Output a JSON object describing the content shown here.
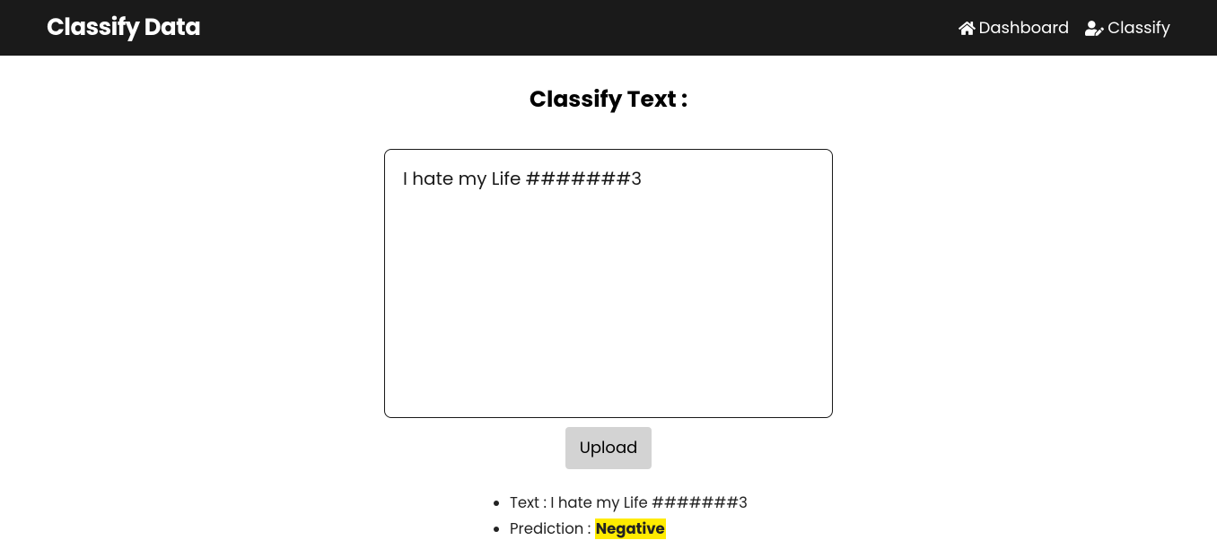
{
  "navbar": {
    "brand": "Classify Data",
    "links": {
      "dashboard": "Dashboard",
      "classify": "Classify"
    }
  },
  "main": {
    "title": "Classify Text :",
    "textarea_value": "I hate my Life #######3",
    "upload_button": "Upload",
    "results": {
      "text_label": "Text : ",
      "text_value": "I hate my Life #######3",
      "prediction_label": "Prediction : ",
      "prediction_value": "Negative"
    }
  }
}
